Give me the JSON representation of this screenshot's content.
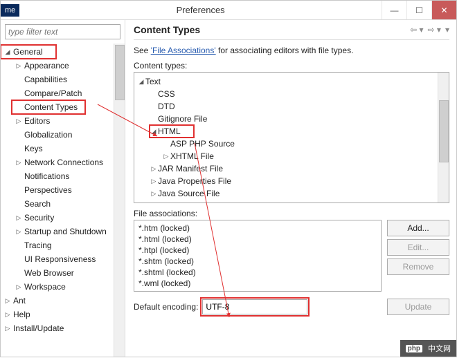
{
  "window": {
    "tag": "me",
    "title": "Preferences"
  },
  "filter_placeholder": "type filter text",
  "left_tree": {
    "general": "General",
    "items": [
      "Appearance",
      "Capabilities",
      "Compare/Patch",
      "Content Types",
      "Editors",
      "Globalization",
      "Keys",
      "Network Connections",
      "Notifications",
      "Perspectives",
      "Search",
      "Security",
      "Startup and Shutdown",
      "Tracing",
      "UI Responsiveness",
      "Web Browser",
      "Workspace"
    ],
    "siblings": [
      "Ant",
      "Help",
      "Install/Update"
    ]
  },
  "right": {
    "heading": "Content Types",
    "desc_prefix": "See ",
    "desc_link": "'File Associations'",
    "desc_suffix": " for associating editors with file types.",
    "ct_label": "Content types:",
    "ct_tree": {
      "text": "Text",
      "text_children": [
        "CSS",
        "DTD",
        "Gitignore File"
      ],
      "html": "HTML",
      "html_children": [
        "ASP PHP Source",
        "XHTML File"
      ],
      "after_html": [
        "JAR Manifest File",
        "Java Properties File",
        "Java Source File"
      ]
    },
    "fa_label": "File associations:",
    "fa_items": [
      "*.htm (locked)",
      "*.html (locked)",
      "*.htpl (locked)",
      "*.shtm (locked)",
      "*.shtml (locked)",
      "*.wml (locked)"
    ],
    "buttons": {
      "add": "Add...",
      "edit": "Edit...",
      "remove": "Remove",
      "update": "Update"
    },
    "encoding_label": "Default encoding:",
    "encoding_value": "UTF-8"
  },
  "watermark": "中文网"
}
